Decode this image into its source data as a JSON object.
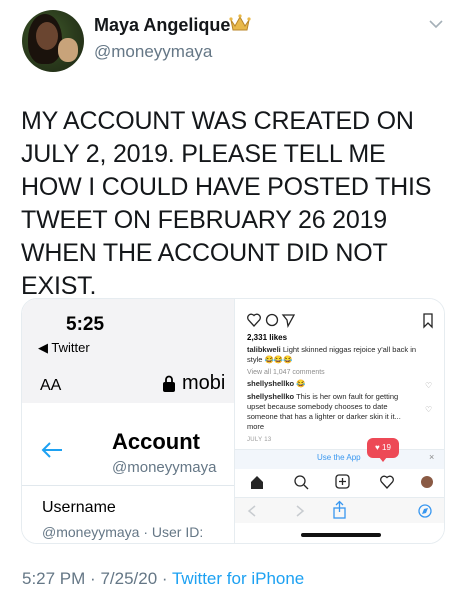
{
  "author": {
    "name": "Maya Angelique",
    "handle": "@moneyymaya"
  },
  "tweet": {
    "text": "MY ACCOUNT WAS CREATED ON JULY 2, 2019. PLEASE TELL ME HOW I COULD HAVE POSTED THIS TWEET ON FEBRUARY 26 2019 WHEN THE ACCOUNT DID NOT EXIST."
  },
  "left_screenshot": {
    "time": "5:25",
    "back_label": "◀ Twitter",
    "text_size_label": "AA",
    "url_partial": "mobi",
    "title": "Account",
    "handle": "@moneyymaya",
    "field_label": "Username",
    "field_value": "@moneyymaya · User ID:"
  },
  "right_screenshot": {
    "likes": "2,331 likes",
    "caption_user": "talibkweli",
    "caption_text": "Light skinned niggas rejoice y'all back in style 😂😂😂",
    "view_all": "View all 1,047 comments",
    "comment1_user": "shellyshellko",
    "comment1_text": "😂",
    "comment2_user": "shellyshellko",
    "comment2_text": "This is her own fault for getting upset because somebody chooses to date someone that has a lighter or darker skin it it... more",
    "date": "JULY 13",
    "use_app": "Use the App",
    "badge_count": "19",
    "close": "×"
  },
  "footer": {
    "time": "5:27 PM",
    "date": "7/25/20",
    "source": "Twitter for iPhone"
  },
  "colors": {
    "link": "#1da1f2",
    "muted": "#657786",
    "text": "#14171a"
  }
}
